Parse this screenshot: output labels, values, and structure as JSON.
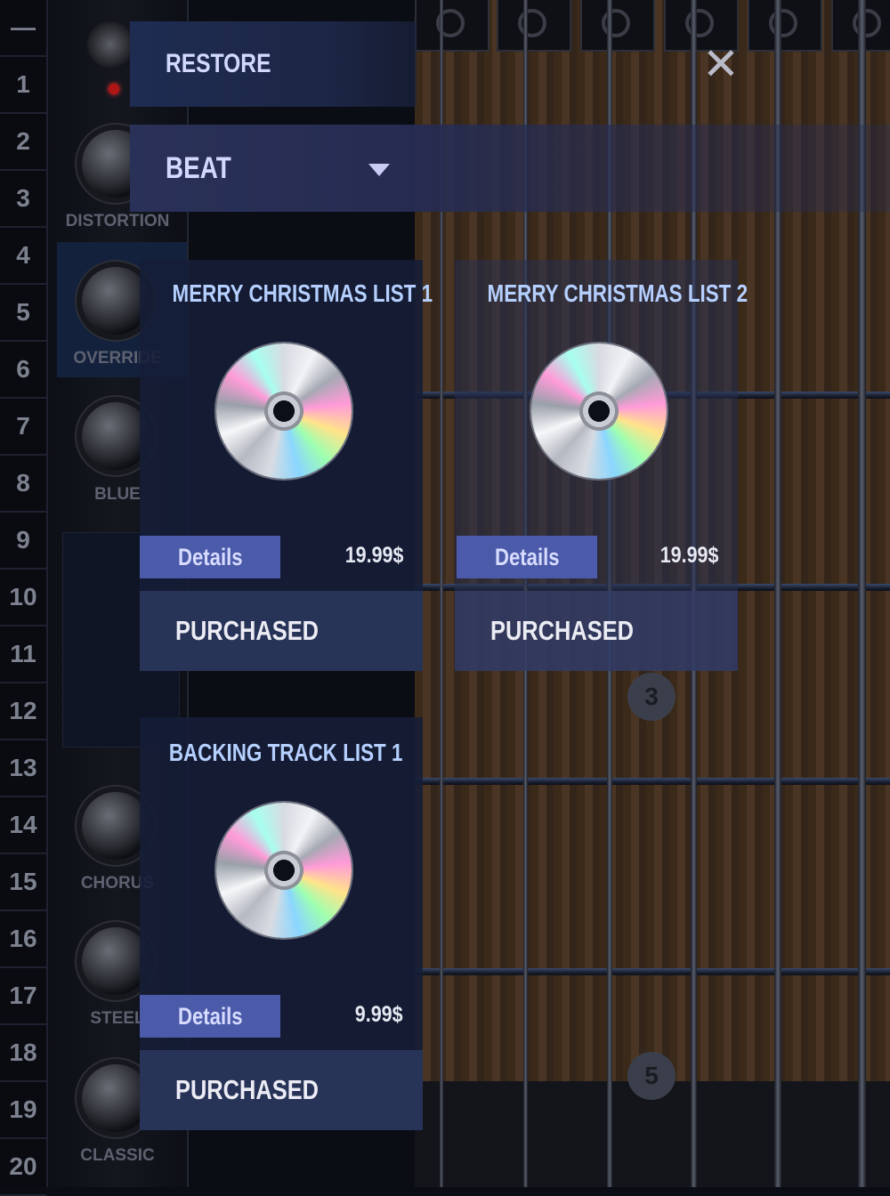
{
  "background": {
    "fret_numbers": [
      "—",
      "1",
      "2",
      "3",
      "4",
      "5",
      "6",
      "7",
      "8",
      "9",
      "10",
      "11",
      "12",
      "13",
      "14",
      "15",
      "16",
      "17",
      "18",
      "19",
      "20"
    ],
    "effects": {
      "distortion": "DISTORTION",
      "override": "OVERRIDE",
      "blue": "BLUE",
      "chorus": "CHORUS",
      "steel": "STEEL",
      "classic": "CLASSIC"
    },
    "fret_markers": [
      "3",
      "5"
    ]
  },
  "store": {
    "restore_label": "RESTORE",
    "close_icon": "close-icon",
    "category": {
      "selected": "BEAT",
      "icon": "chevron-down-icon"
    },
    "products": [
      {
        "title": "MERRY CHRISTMAS LIST 1",
        "icon": "cd-icon",
        "details_label": "Details",
        "price": "19.99$",
        "status": "PURCHASED"
      },
      {
        "title": "MERRY CHRISTMAS LIST 2",
        "icon": "cd-icon",
        "details_label": "Details",
        "price": "19.99$",
        "status": "PURCHASED"
      },
      {
        "title": "BACKING TRACK LIST 1",
        "icon": "cd-icon",
        "details_label": "Details",
        "price": "9.99$",
        "status": "PURCHASED"
      }
    ]
  },
  "colors": {
    "accent_button": "#4b5aa9",
    "title_text": "#b5d0ff",
    "panel": "#1f2c52"
  }
}
